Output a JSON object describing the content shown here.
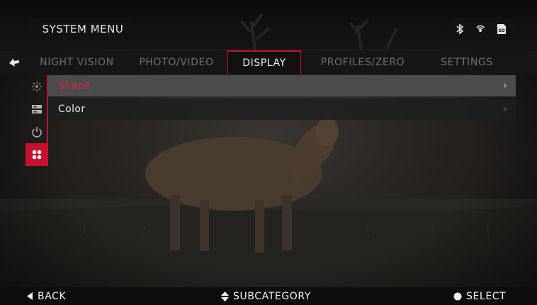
{
  "header": {
    "title": "SYSTEM MENU",
    "status_icons": [
      "bluetooth-icon",
      "wifi-icon",
      "sd-card-icon"
    ],
    "sd_label": "SD"
  },
  "tabs": [
    {
      "label": "NIGHT VISION",
      "active": false
    },
    {
      "label": "PHOTO/VIDEO",
      "active": false
    },
    {
      "label": "DISPLAY",
      "active": true
    },
    {
      "label": "PROFILES/ZERO",
      "active": false
    },
    {
      "label": "SETTINGS",
      "active": false
    }
  ],
  "sidebar": {
    "items": [
      {
        "icon": "brightness-icon",
        "active": false
      },
      {
        "icon": "layout-icon",
        "active": false
      },
      {
        "icon": "power-icon",
        "active": false
      },
      {
        "icon": "reticle-dots-icon",
        "active": true
      }
    ]
  },
  "menu": {
    "items": [
      {
        "label": "Shape",
        "selected": true
      },
      {
        "label": "Color",
        "selected": false
      }
    ],
    "chevron": "›"
  },
  "footer": {
    "back": "BACK",
    "subcategory": "SUBCATEGORY",
    "select": "SELECT"
  },
  "colors": {
    "accent": "#c8102e",
    "selected_text": "#d8263c"
  }
}
